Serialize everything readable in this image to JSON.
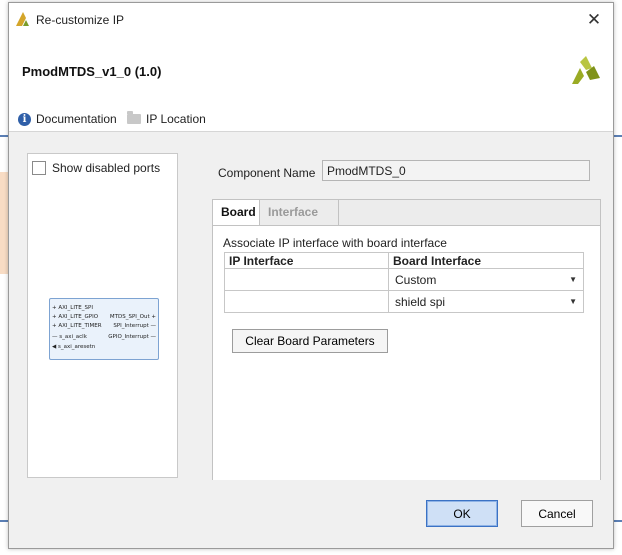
{
  "window": {
    "title": "Re-customize IP"
  },
  "header": {
    "ip_name": "PmodMTDS_v1_0 (1.0)",
    "documentation_label": "Documentation",
    "ip_location_label": "IP Location"
  },
  "left_panel": {
    "show_disabled_ports_label": "Show disabled ports",
    "ip_block": {
      "left_ports": [
        "AXI_LITE_SPI",
        "AXI_LITE_GPIO",
        "AXI_LITE_TIMER",
        "s_axi_aclk",
        "s_axi_aresetn"
      ],
      "right_ports": [
        "MTDS_SPI_Out",
        "SPI_Interrupt",
        "GPIO_Interrupt"
      ]
    }
  },
  "component": {
    "label": "Component Name",
    "value": "PmodMTDS_0"
  },
  "tabs": [
    {
      "label": "Board"
    },
    {
      "label": "Interface"
    }
  ],
  "board_tab": {
    "description": "Associate IP interface with board interface",
    "columns": [
      "IP Interface",
      "Board Interface"
    ],
    "rows": [
      {
        "ip_interface": "",
        "board_interface": "Custom"
      },
      {
        "ip_interface": "",
        "board_interface": "shield spi"
      }
    ],
    "clear_button": "Clear Board Parameters"
  },
  "footer": {
    "ok_label": "OK",
    "cancel_label": "Cancel"
  },
  "colors": {
    "accent": "#3b72c4",
    "logo_green": "#9aab24",
    "info_blue": "#2f5fa8"
  }
}
